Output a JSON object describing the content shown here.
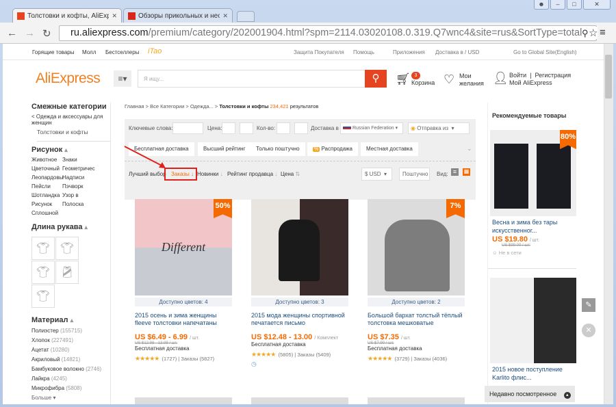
{
  "browser": {
    "tabs": [
      {
        "title": "Толстовки и кофты, AliExpr",
        "active": true
      },
      {
        "title": "Обзоры прикольных и необ",
        "active": false
      }
    ],
    "url_host": "ru.aliexpress.com",
    "url_path": "/premium/category/202001904.html?spm=2114.03020108.0.319.Q7wnc4&site=rus&SortType=total"
  },
  "topnav": {
    "left": [
      "Горящие товары",
      "Молл",
      "Бестселлеры"
    ],
    "itao": "iTao",
    "right": [
      "Защита Покупателя",
      "Помощь",
      "Приложения",
      "Доставка в / USD",
      "Go to Global Site(English)"
    ]
  },
  "header": {
    "logo": "AliExpress",
    "search_placeholder": "Я ищу...",
    "cart_count": "3",
    "cart_label": "Корзина",
    "wish1": "Мои",
    "wish2": "желания",
    "login": "Войти",
    "register": "Регистрация",
    "my": "Мой AliExpress"
  },
  "sidebar": {
    "related_title": "Смежные категории",
    "parent": "< Одежда и аксессуары для женщин",
    "current": "Толстовки и кофты",
    "pattern_title": "Рисунок",
    "patterns": [
      "Животное",
      "Знаки",
      "Цветочный",
      "Геометричес",
      "Леопардовы",
      "Надписи",
      "Пейсли",
      "Пэчворк",
      "Шотландка",
      "Узор в",
      "Рисунок",
      "Полоска",
      "Сплошной"
    ],
    "sleeve_title": "Длина рукава",
    "material_title": "Материал",
    "materials": [
      {
        "name": "Полиэстер",
        "count": "(155715)"
      },
      {
        "name": "Хлопок",
        "count": "(227491)"
      },
      {
        "name": "Ацетат",
        "count": "(10280)"
      },
      {
        "name": "Акриловый",
        "count": "(14821)"
      },
      {
        "name": "Бамбуковое волокно",
        "count": "(2746)"
      },
      {
        "name": "Лайкра",
        "count": "(4245)"
      },
      {
        "name": "Микрофибра",
        "count": "(5808)"
      }
    ],
    "more": "Больше"
  },
  "breadcrumb": {
    "path": "Главная > Все Категории > Одежда... >",
    "current": "Толстовки и кофты",
    "count": "234,421",
    "suffix": "результатов"
  },
  "filters": {
    "keywords": "Ключевые слова:",
    "price": "Цена:",
    "qty": "Кол-во:",
    "ship_to": "Доставка в",
    "country": "Russian Federation",
    "ship_from": "Отправка из",
    "buttons": [
      "Бесплатная доставка",
      "Высший рейтинг",
      "Только поштучно",
      "Распродажа",
      "Местная доставка"
    ]
  },
  "sort": {
    "items": [
      "Лучший выбор",
      "Заказы",
      "Новинки",
      "Рейтинг продавца",
      "Цена"
    ],
    "currency": "$ USD",
    "unit": "Поштучно",
    "view": "Вид:"
  },
  "products": [
    {
      "badge": "50",
      "colors": "Доступно цветов: 4",
      "title": "2015 осень и зима женщины fleeve толстовки напечатаны",
      "price": "US $6.49 - 6.99",
      "unit": "/ шт.",
      "old": "US $12.98 - 13.98 / шт.",
      "ship": "Бесплатная доставка",
      "reviews": "(1727)",
      "orders": "Заказы (5827)",
      "img": "#f2c6c8"
    },
    {
      "badge": "",
      "colors": "Доступно цветов: 3",
      "title": "2015 мода женщины спортивной печатается письмо",
      "price": "US $12.48 - 13.00",
      "unit": "/ Комплект",
      "old": "",
      "ship": "Бесплатная доставка",
      "reviews": "(5805)",
      "orders": "Заказы (5409)",
      "img": "#3a2a2a"
    },
    {
      "badge": "7",
      "colors": "Доступно цветов: 2",
      "title": "Большой бархат толстый тёплый толстовка мешковатые",
      "price": "US $7.35",
      "unit": "/ шт.",
      "old": "US $7.90 / шт.",
      "ship": "Бесплатная доставка",
      "reviews": "(3729)",
      "orders": "Заказы (4036)",
      "img": "#8a8a8a"
    }
  ],
  "recommended": {
    "title": "Рекомендуемые товары",
    "items": [
      {
        "badge": "80",
        "title": "Весна и зима без тары искусственног...",
        "price": "US $19.80",
        "unit": "/ шт.",
        "old": "US $99.00 / шт.",
        "status": "Не в сети"
      },
      {
        "title": "2015 новое поступление Karlito флис..."
      }
    ]
  },
  "recent": "Недавно посмотренное"
}
